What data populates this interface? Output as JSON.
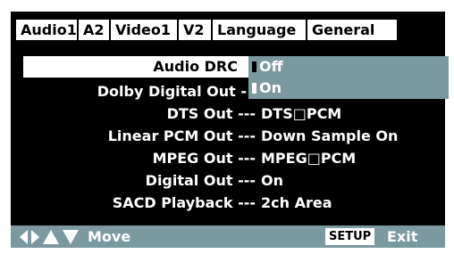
{
  "tabs": [
    {
      "label": "Audio1"
    },
    {
      "label": "A2"
    },
    {
      "label": "Video1"
    },
    {
      "label": "V2"
    },
    {
      "label": "Language"
    },
    {
      "label": "General"
    }
  ],
  "highlighted_setting": {
    "label": "Audio DRC"
  },
  "settings": [
    {
      "label": "Dolby Digital Out -",
      "value": ""
    },
    {
      "label": "DTS Out ---",
      "value": "DTS□PCM"
    },
    {
      "label": "Linear PCM Out ---",
      "value": "Down Sample On"
    },
    {
      "label": "MPEG Out ---",
      "value": "MPEG□PCM"
    },
    {
      "label": "Digital Out ---",
      "value": "On"
    },
    {
      "label": "SACD Playback ---",
      "value": "2ch Area"
    }
  ],
  "dropdown": {
    "options": [
      {
        "label": "Off",
        "selected": true
      },
      {
        "label": "On",
        "selected": false
      }
    ]
  },
  "footer": {
    "move_label": "Move",
    "setup_label": "SETUP",
    "exit_label": "Exit",
    "nav_icons": [
      "left-arrow-icon",
      "right-arrow-icon",
      "up-arrow-icon",
      "down-arrow-icon"
    ]
  },
  "colors": {
    "background": "#000000",
    "accent": "#7a9aa0",
    "text": "#ffffff",
    "highlight": "#ffffff"
  }
}
